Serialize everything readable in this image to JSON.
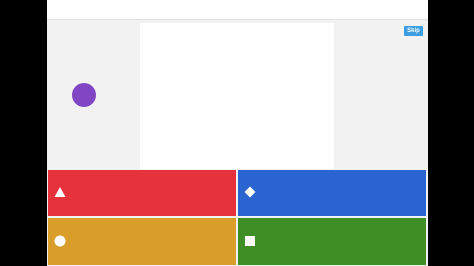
{
  "skip": {
    "label": "Skip",
    "color": "#3b9ee0"
  },
  "stage": {
    "indicator_color": "#8046c3"
  },
  "answers": [
    {
      "shape": "triangle-icon",
      "color": "#e5323b"
    },
    {
      "shape": "diamond-icon",
      "color": "#2a64d0"
    },
    {
      "shape": "circle-icon",
      "color": "#d99d2a"
    },
    {
      "shape": "square-icon",
      "color": "#3d8e24"
    }
  ]
}
